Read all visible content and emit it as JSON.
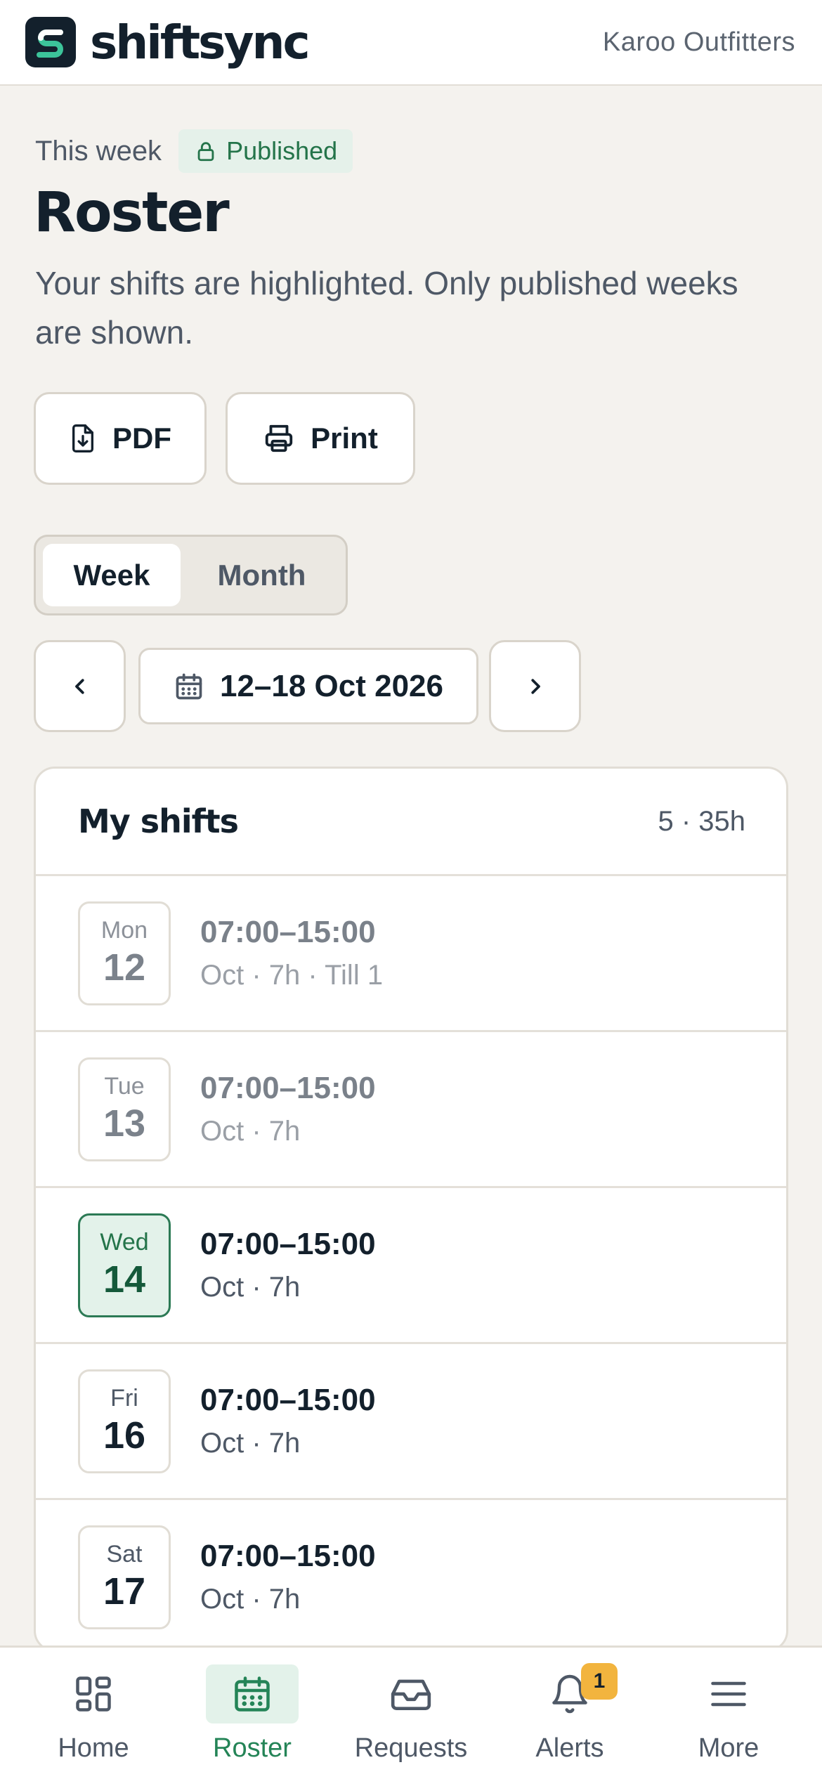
{
  "app": {
    "brand_name": "shiftsync",
    "organization": "Karoo Outfitters"
  },
  "header": {
    "eyebrow": "This week",
    "badge": "Published",
    "title": "Roster",
    "subtitle": "Your shifts are highlighted. Only published weeks are shown."
  },
  "actions": {
    "pdf_label": "PDF",
    "print_label": "Print"
  },
  "view_toggle": {
    "week_label": "Week",
    "month_label": "Month",
    "selected": "Week"
  },
  "week_nav": {
    "range_label": "12–18 Oct 2026"
  },
  "my_shifts": {
    "title": "My shifts",
    "summary": "5 · 35h",
    "rows": [
      {
        "day": "Mon",
        "date": "12",
        "time": "07:00–15:00",
        "meta": "Oct · 7h · Till 1",
        "state": "past"
      },
      {
        "day": "Tue",
        "date": "13",
        "time": "07:00–15:00",
        "meta": "Oct · 7h",
        "state": "past"
      },
      {
        "day": "Wed",
        "date": "14",
        "time": "07:00–15:00",
        "meta": "Oct · 7h",
        "state": "today"
      },
      {
        "day": "Fri",
        "date": "16",
        "time": "07:00–15:00",
        "meta": "Oct · 7h",
        "state": "upcoming"
      },
      {
        "day": "Sat",
        "date": "17",
        "time": "07:00–15:00",
        "meta": "Oct · 7h",
        "state": "upcoming"
      }
    ]
  },
  "bottom_nav": {
    "home": "Home",
    "roster": "Roster",
    "requests": "Requests",
    "alerts": "Alerts",
    "alerts_count": "1",
    "more": "More",
    "active": "Roster"
  },
  "colors": {
    "ink": "#13202c",
    "accent_green": "#248457",
    "today_fill": "#e3f2ea",
    "badge_amber": "#f2b43e",
    "page_bg": "#f4f2ee"
  }
}
